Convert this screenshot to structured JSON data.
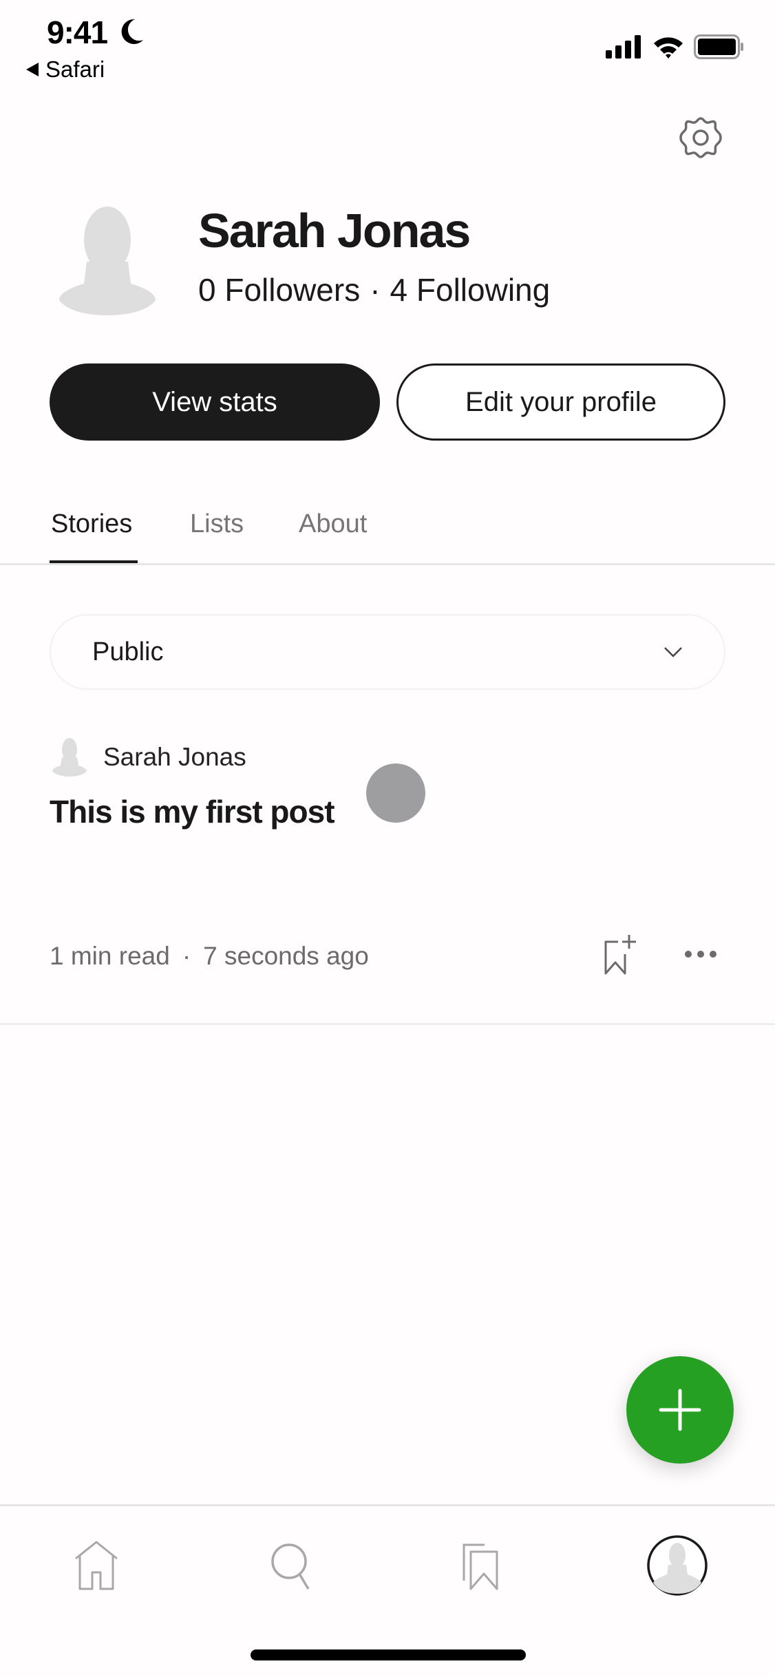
{
  "status_bar": {
    "time": "9:41",
    "back_label": "Safari",
    "icons": [
      "moon-icon",
      "signal-icon",
      "wifi-icon",
      "battery-icon"
    ]
  },
  "header": {
    "settings_icon": "gear-icon"
  },
  "profile": {
    "name": "Sarah Jonas",
    "followers": "0 Followers",
    "separator": "·",
    "following": "4 Following"
  },
  "actions": {
    "view_stats_label": "View stats",
    "edit_profile_label": "Edit your profile"
  },
  "tabs": [
    {
      "label": "Stories",
      "active": true
    },
    {
      "label": "Lists",
      "active": false
    },
    {
      "label": "About",
      "active": false
    }
  ],
  "filter": {
    "selected": "Public"
  },
  "posts": [
    {
      "author": "Sarah Jonas",
      "title": "This is my first post",
      "read_time": "1 min read",
      "separator": "·",
      "posted": "7 seconds ago"
    }
  ],
  "bottom_nav": [
    {
      "icon": "home-icon",
      "active": false
    },
    {
      "icon": "search-icon",
      "active": false
    },
    {
      "icon": "bookmarks-icon",
      "active": false
    },
    {
      "icon": "profile-avatar-icon",
      "active": true
    }
  ],
  "colors": {
    "accent_green": "#26a023",
    "primary_dark": "#1c1b1c",
    "muted_text": "#6b6b6b"
  }
}
